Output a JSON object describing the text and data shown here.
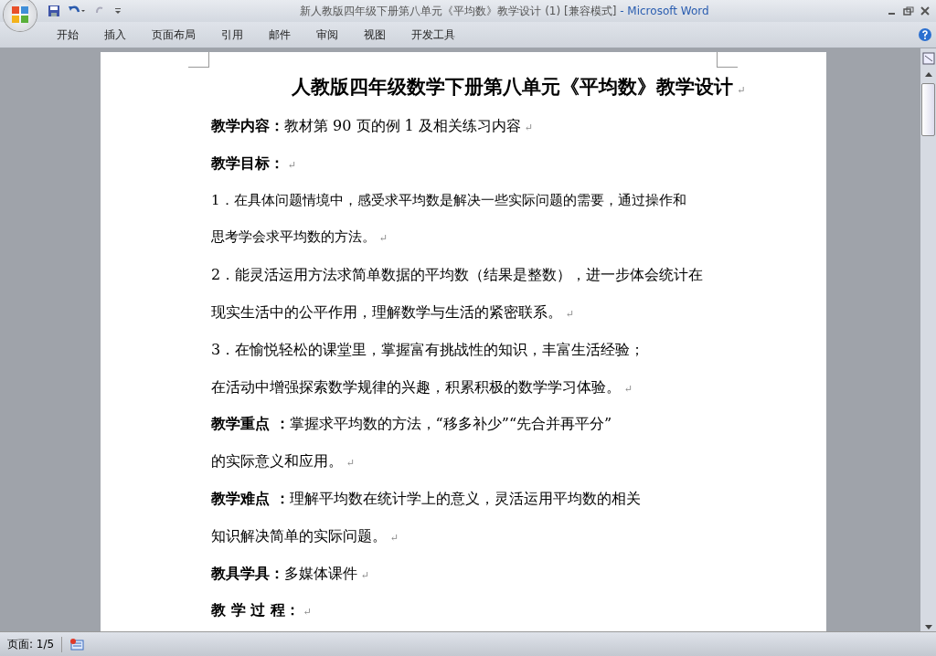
{
  "window": {
    "title_document": "新人教版四年级下册第八单元《平均数》教学设计 (1) [兼容模式]",
    "title_app": "- Microsoft Word"
  },
  "ribbon_tabs": [
    {
      "label": "开始",
      "selected": false
    },
    {
      "label": "插入",
      "selected": false
    },
    {
      "label": "页面布局",
      "selected": false
    },
    {
      "label": "引用",
      "selected": false
    },
    {
      "label": "邮件",
      "selected": false
    },
    {
      "label": "审阅",
      "selected": false
    },
    {
      "label": "视图",
      "selected": false
    },
    {
      "label": "开发工具",
      "selected": false
    }
  ],
  "document": {
    "paragraphs": [
      {
        "kind": "title",
        "lines": [
          "人教版四年级数学下册第八单元《平均数》教学设计"
        ],
        "mark": "↵"
      },
      {
        "kind": "body",
        "lines": [
          "**教学内容：**教材第 90 页的例 1 及相关练习内容"
        ],
        "mark": "↵"
      },
      {
        "kind": "heading",
        "lines": [
          "教学目标："
        ],
        "mark": "↵"
      },
      {
        "kind": "small",
        "lines": [
          "1．在具体问题情境中，感受求平均数是解决一些实际问题的需要，通过操作和",
          "思考学会求平均数的方法。"
        ],
        "mark": "↵"
      },
      {
        "kind": "body",
        "lines": [
          "2．能灵活运用方法求简单数据的平均数（结果是整数），进一步体会统计在",
          "现实生活中的公平作用，理解数学与生活的紧密联系。"
        ],
        "mark": "↵"
      },
      {
        "kind": "body",
        "lines": [
          "3．在愉悦轻松的课堂里，掌握富有挑战性的知识，丰富生活经验；",
          "在活动中增强探索数学规律的兴趣，积累积极的数学学习体验。"
        ],
        "mark": "↵"
      },
      {
        "kind": "body",
        "lines": [
          "**教学重点 ：**掌握求平均数的方法，“移多补少”“先合并再平分”",
          "的实际意义和应用。"
        ],
        "mark": "↵"
      },
      {
        "kind": "body",
        "lines": [
          "**教学难点 ：**理解平均数在统计学上的意义，灵活运用平均数的相关",
          "知识解决简单的实际问题。"
        ],
        "mark": "↵"
      },
      {
        "kind": "body",
        "lines": [
          "**教具学具：**多媒体课件"
        ],
        "mark": "↵"
      },
      {
        "kind": "heading",
        "lines": [
          "教 学 过 程："
        ],
        "mark": "↵"
      }
    ]
  },
  "status_bar": {
    "page": "页面: 1/5"
  }
}
